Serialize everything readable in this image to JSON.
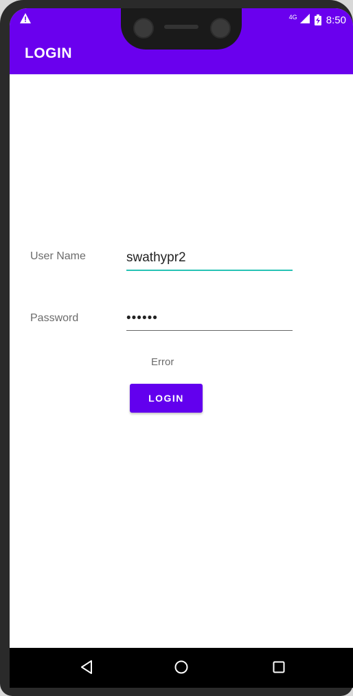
{
  "status_bar": {
    "network": "4G",
    "time": "8:50",
    "icons": [
      "warning-icon",
      "signal-icon",
      "battery-icon"
    ]
  },
  "app_bar": {
    "title": "LOGIN"
  },
  "form": {
    "username_label": "User Name",
    "username_value": "swathypr2",
    "password_label": "Password",
    "password_value": "••••••",
    "error_text": "Error",
    "login_button": "LOGIN"
  },
  "nav_bar": {
    "icons": [
      "back-icon",
      "home-icon",
      "recents-icon"
    ]
  },
  "colors": {
    "app_bar": "#6a00ee",
    "button": "#6200ee",
    "focus_underline": "#26c2b4"
  }
}
